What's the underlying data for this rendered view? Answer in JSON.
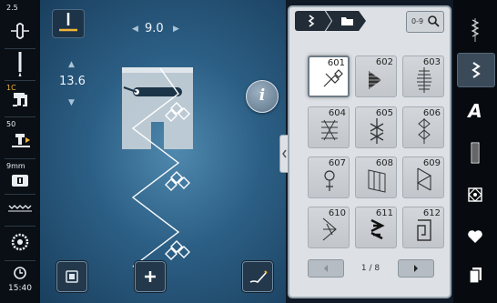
{
  "status": {
    "needle_position_value": "2.5",
    "thread_tension_value": "1C",
    "presser_foot_pressure_value": "50",
    "stitch_plate_value": "9mm",
    "time": "15:40"
  },
  "stitch": {
    "width": "9.0",
    "length": "13.6"
  },
  "panel": {
    "search_label": "0-9",
    "page_indicator": "1 / 8",
    "stitches": [
      {
        "number": "601",
        "selected": true
      },
      {
        "number": "602",
        "selected": false
      },
      {
        "number": "603",
        "selected": false
      },
      {
        "number": "604",
        "selected": false
      },
      {
        "number": "605",
        "selected": false
      },
      {
        "number": "606",
        "selected": false
      },
      {
        "number": "607",
        "selected": false
      },
      {
        "number": "608",
        "selected": false
      },
      {
        "number": "609",
        "selected": false
      },
      {
        "number": "610",
        "selected": false
      },
      {
        "number": "611",
        "selected": false
      },
      {
        "number": "612",
        "selected": false
      }
    ]
  },
  "right_menu": {
    "active_item": "decorative-stitches",
    "alphabet_label": "A"
  },
  "colors": {
    "background": "#2c5f85",
    "panel": "#dde1e5",
    "status_accent": "#f2b43a",
    "selected_tile": "#ffffff"
  }
}
